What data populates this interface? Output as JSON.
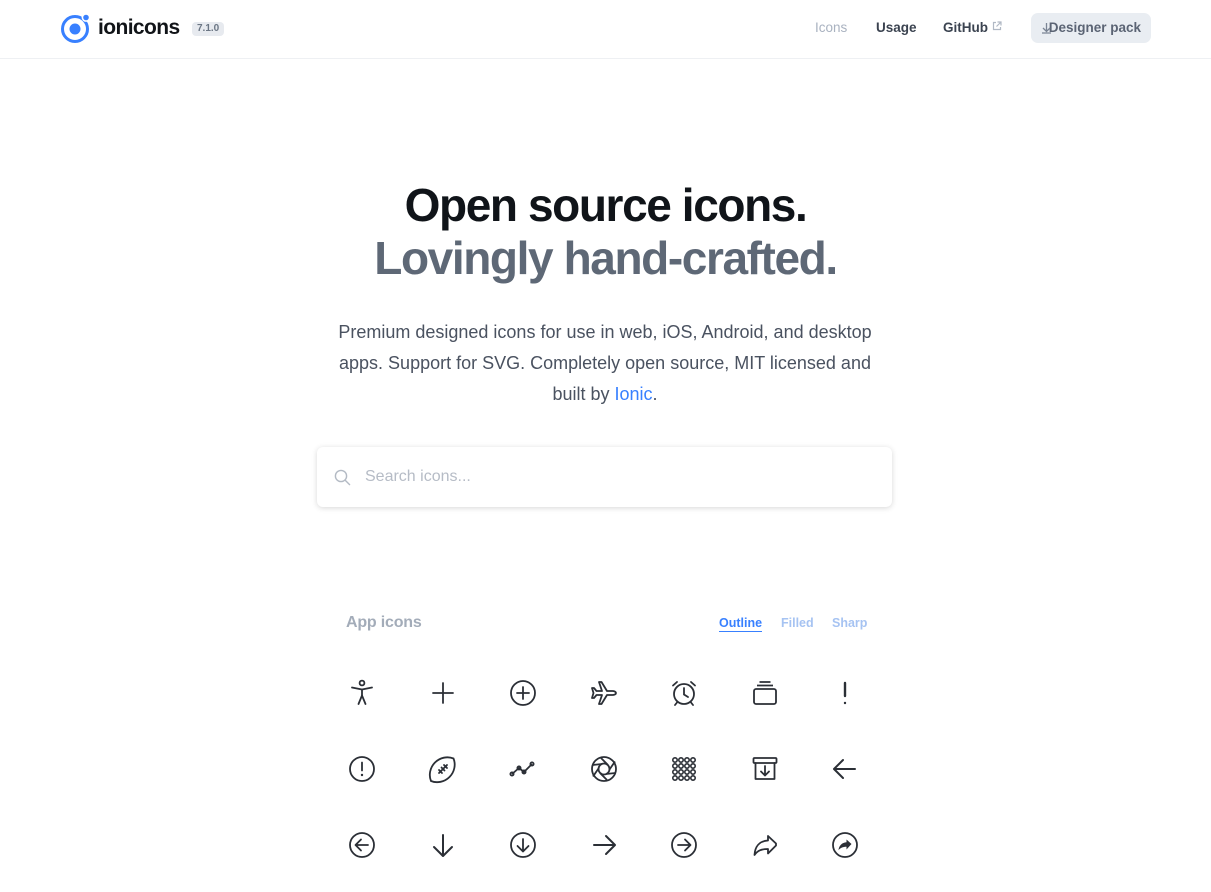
{
  "header": {
    "brand": "ionicons",
    "version": "7.1.0",
    "nav": {
      "icons": "Icons",
      "usage": "Usage",
      "github": "GitHub"
    },
    "designer_pack": "Designer pack"
  },
  "hero": {
    "line1": "Open source icons.",
    "line2": "Lovingly hand-crafted.",
    "desc_1": "Premium designed icons for use in web, iOS, Android, and desktop apps. Support for SVG. Completely open source, MIT licensed and built by",
    "desc_link": "Ionic",
    "desc_end": "."
  },
  "search": {
    "placeholder": "Search icons..."
  },
  "section": {
    "title": "App icons",
    "tabs": {
      "outline": "Outline",
      "filled": "Filled",
      "sharp": "Sharp"
    },
    "active_tab": "Outline"
  },
  "icons": [
    "accessibility-icon",
    "add-icon",
    "add-circle-icon",
    "airplane-icon",
    "alarm-icon",
    "albums-icon",
    "alert-icon",
    "alert-circle-icon",
    "american-football-icon",
    "analytics-icon",
    "aperture-icon",
    "apps-icon",
    "archive-icon",
    "arrow-back-icon",
    "arrow-back-circle-icon",
    "arrow-down-icon",
    "arrow-down-circle-icon",
    "arrow-forward-icon",
    "arrow-forward-circle-icon",
    "arrow-redo-icon",
    "arrow-redo-circle-icon"
  ],
  "colors": {
    "accent": "#3880ff",
    "text": "#101419",
    "muted": "#5e6876",
    "icon": "#2b2f36"
  }
}
